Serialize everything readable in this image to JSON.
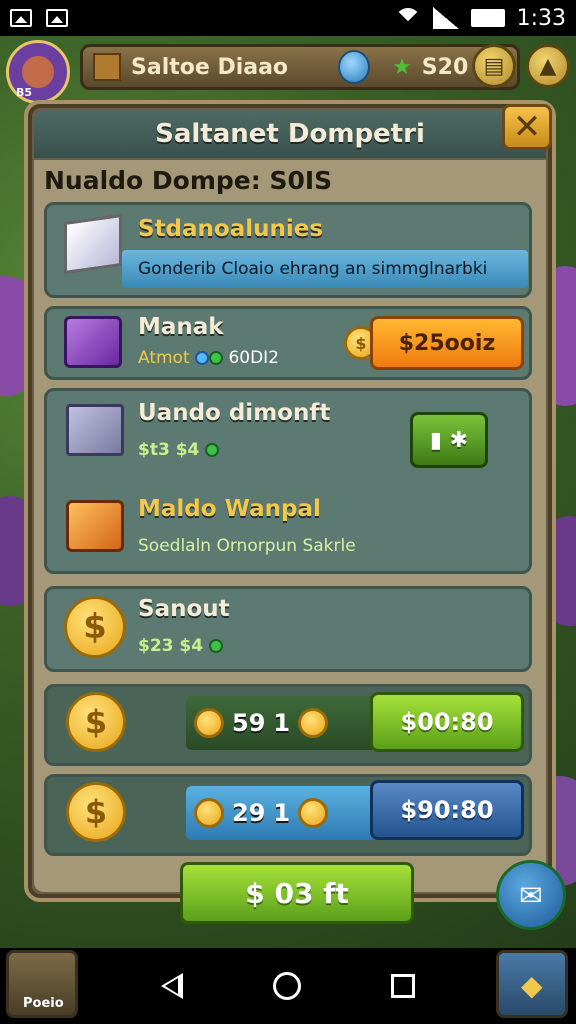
{
  "status_bar": {
    "time": "1:33"
  },
  "hud": {
    "title": "Saltoe Diaao",
    "currency": "S20",
    "avatar_label": "B5"
  },
  "panel": {
    "title": "Saltanet Dompetri",
    "subtitle": "Nualdo Dompe: S0IS"
  },
  "cards": {
    "info": {
      "title": "Stdanoalunies",
      "bar_text": "Gonderib Cloaio ehrang an simmglnarbki"
    },
    "manak": {
      "title": "Manak",
      "sub_label": "Atmot",
      "sub_value": "60DI2",
      "button": "$25ooiz"
    },
    "uando": {
      "title": "Uando dimonft",
      "sub": "$t3 $4"
    },
    "maldo": {
      "title": "Maldo Wanpal",
      "sub": "Soedlaln Ornorpun Sakrle"
    },
    "sanout": {
      "title": "Sanout",
      "sub": "$23 $4"
    }
  },
  "rows": [
    {
      "amount": "59",
      "count": "1",
      "button": "$00:80",
      "style": "green"
    },
    {
      "amount": "29",
      "count": "1",
      "button": "$90:80",
      "style": "blue"
    }
  ],
  "footer": {
    "main_button": "$ 03 ft",
    "corner_label": "Poeio"
  },
  "colors": {
    "accent": "#f5c24a",
    "green": "#7ac43a",
    "blue": "#3a6aa8",
    "panel": "#a59878"
  }
}
